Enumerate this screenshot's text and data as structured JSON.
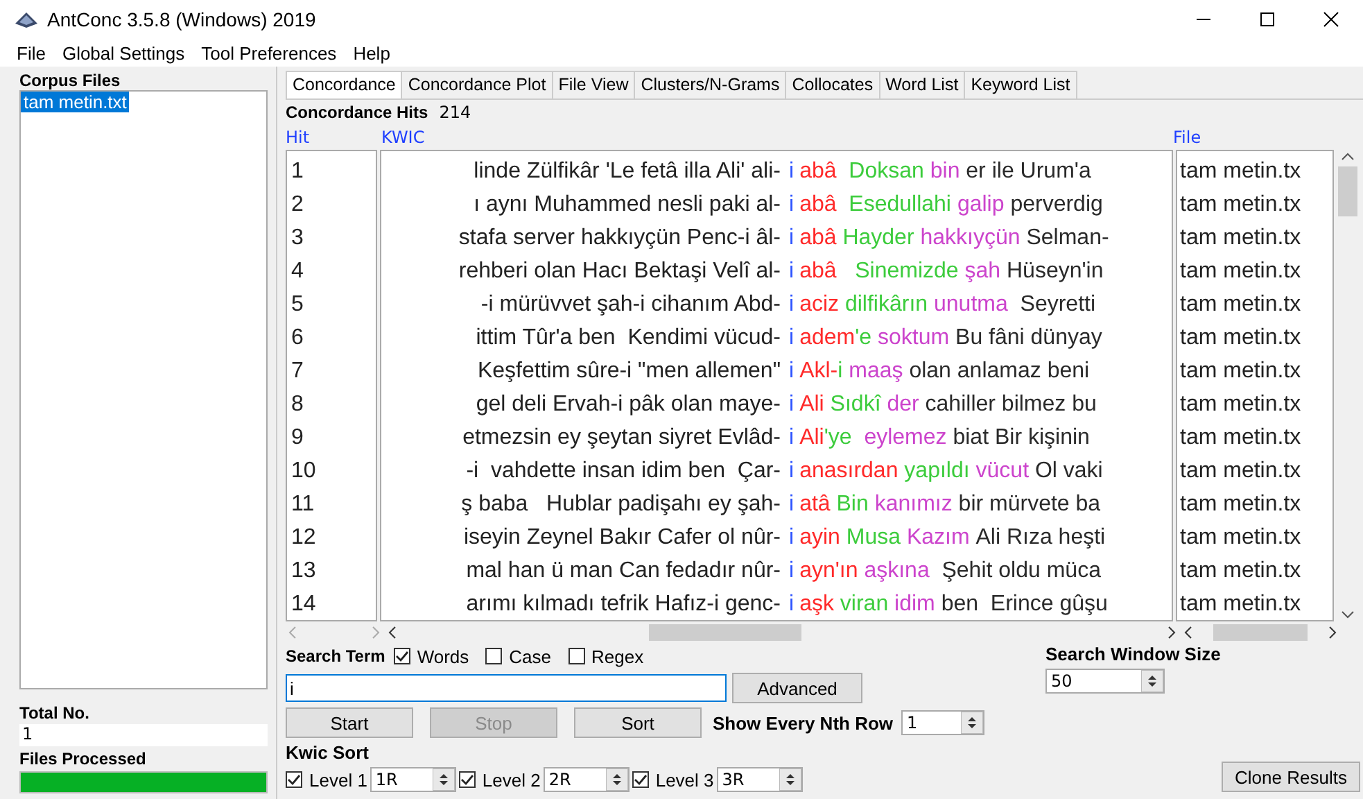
{
  "window": {
    "title": "AntConc 3.5.8 (Windows) 2019"
  },
  "menu": [
    "File",
    "Global Settings",
    "Tool Preferences",
    "Help"
  ],
  "corpus_files": {
    "title": "Corpus Files",
    "items": [
      {
        "label": "tam metin.txt",
        "selected": true
      }
    ],
    "total_label": "Total No.",
    "total_value": "1",
    "processed_label": "Files Processed",
    "processed": {
      "level": 1
    }
  },
  "tabs": [
    {
      "label": "Concordance",
      "selected": true
    },
    {
      "label": "Concordance Plot",
      "selected": false
    },
    {
      "label": "File View",
      "selected": false
    },
    {
      "label": "Clusters/N-Grams",
      "selected": false
    },
    {
      "label": "Collocates",
      "selected": false
    },
    {
      "label": "Word List",
      "selected": false
    },
    {
      "label": "Keyword List",
      "selected": false
    }
  ],
  "concordance": {
    "hits_label": "Concordance Hits",
    "hits_count": "214",
    "columns": [
      "Hit",
      "KWIC",
      "File"
    ],
    "rows": [
      {
        "hit": "1",
        "left": "linde Zülfikâr 'Le fetâ illa Ali' ali-",
        "node": "i",
        "right": [
          {
            "text": "abâ  ",
            "kind": "level1"
          },
          {
            "text": "Doksan ",
            "kind": "level2"
          },
          {
            "text": "bin ",
            "kind": "level3"
          },
          {
            "text": "er ile Urum'a",
            "kind": "plain"
          }
        ],
        "file": "tam metin.tx"
      },
      {
        "hit": "2",
        "left": "ı aynı Muhammed nesli paki al-",
        "node": "i",
        "right": [
          {
            "text": "abâ  ",
            "kind": "level1"
          },
          {
            "text": "Esedullahi ",
            "kind": "level2"
          },
          {
            "text": "galip ",
            "kind": "level3"
          },
          {
            "text": "perverdig",
            "kind": "plain"
          }
        ],
        "file": "tam metin.tx"
      },
      {
        "hit": "3",
        "left": "stafa server hakkıyçün Penc-i âl-",
        "node": "i",
        "right": [
          {
            "text": "abâ ",
            "kind": "level1"
          },
          {
            "text": "Hayder ",
            "kind": "level2"
          },
          {
            "text": "hakkıyçün ",
            "kind": "level3"
          },
          {
            "text": "Selman-",
            "kind": "plain"
          }
        ],
        "file": "tam metin.tx"
      },
      {
        "hit": "4",
        "left": "rehberi olan Hacı Bektaşi Velî al-",
        "node": "i",
        "right": [
          {
            "text": "abâ   ",
            "kind": "level1"
          },
          {
            "text": "Sinemizde ",
            "kind": "level2"
          },
          {
            "text": "şah ",
            "kind": "level3"
          },
          {
            "text": "Hüseyn'in",
            "kind": "plain"
          }
        ],
        "file": "tam metin.tx"
      },
      {
        "hit": "5",
        "left": "-i mürüvvet şah-i cihanım Abd-",
        "node": "i",
        "right": [
          {
            "text": "aciz ",
            "kind": "level1"
          },
          {
            "text": "dilfikârın ",
            "kind": "level2"
          },
          {
            "text": "unutma  ",
            "kind": "level3"
          },
          {
            "text": "Seyretti",
            "kind": "plain"
          }
        ],
        "file": "tam metin.tx"
      },
      {
        "hit": "6",
        "left": "ittim Tûr'a ben  Kendimi vücud-",
        "node": "i",
        "right": [
          {
            "text": "adem",
            "kind": "level1"
          },
          {
            "text": "'e ",
            "kind": "level2"
          },
          {
            "text": "soktum ",
            "kind": "level3"
          },
          {
            "text": "Bu fâni dünyay",
            "kind": "plain"
          }
        ],
        "file": "tam metin.tx"
      },
      {
        "hit": "7",
        "left": "Keşfettim sûre-i \"men allemen\"",
        "node": "i",
        "right": [
          {
            "text": "Akl-",
            "kind": "level1"
          },
          {
            "text": "i ",
            "kind": "level2"
          },
          {
            "text": "maaş ",
            "kind": "level3"
          },
          {
            "text": "olan anlamaz beni",
            "kind": "plain"
          }
        ],
        "file": "tam metin.tx"
      },
      {
        "hit": "8",
        "left": "gel deli Ervah-i pâk olan maye-",
        "node": "i",
        "right": [
          {
            "text": "Ali ",
            "kind": "level1"
          },
          {
            "text": "Sıdkî ",
            "kind": "level2"
          },
          {
            "text": "der ",
            "kind": "level3"
          },
          {
            "text": "cahiller bilmez bu",
            "kind": "plain"
          }
        ],
        "file": "tam metin.tx"
      },
      {
        "hit": "9",
        "left": "etmezsin ey şeytan siyret Evlâd-",
        "node": "i",
        "right": [
          {
            "text": "Ali",
            "kind": "level1"
          },
          {
            "text": "'ye  ",
            "kind": "level2"
          },
          {
            "text": "eylemez ",
            "kind": "level3"
          },
          {
            "text": "biat Bir kişinin",
            "kind": "plain"
          }
        ],
        "file": "tam metin.tx"
      },
      {
        "hit": "10",
        "left": "-i  vahdette insan idim ben  Çar-",
        "node": "i",
        "right": [
          {
            "text": "anasırdan ",
            "kind": "level1"
          },
          {
            "text": "yapıldı ",
            "kind": "level2"
          },
          {
            "text": "vücut ",
            "kind": "level3"
          },
          {
            "text": "Ol vaki",
            "kind": "plain"
          }
        ],
        "file": "tam metin.tx"
      },
      {
        "hit": "11",
        "left": "ş baba   Hublar padişahı ey şah-",
        "node": "i",
        "right": [
          {
            "text": "atâ ",
            "kind": "level1"
          },
          {
            "text": "Bin ",
            "kind": "level2"
          },
          {
            "text": "kanımız ",
            "kind": "level3"
          },
          {
            "text": "bir mürvete ba",
            "kind": "plain"
          }
        ],
        "file": "tam metin.tx"
      },
      {
        "hit": "12",
        "left": "iseyin Zeynel Bakır Cafer ol nûr-",
        "node": "i",
        "right": [
          {
            "text": "ayin ",
            "kind": "level1"
          },
          {
            "text": "Musa ",
            "kind": "level2"
          },
          {
            "text": "Kazım ",
            "kind": "level3"
          },
          {
            "text": "Ali Rıza heşti",
            "kind": "plain"
          }
        ],
        "file": "tam metin.tx"
      },
      {
        "hit": "13",
        "left": "mal han ü man Can fedadır nûr-",
        "node": "i",
        "right": [
          {
            "text": "ayn'ın ",
            "kind": "level1"
          },
          {
            "text": "aşkına  ",
            "kind": "level3"
          },
          {
            "text": "Şehit oldu müca",
            "kind": "plain"
          }
        ],
        "file": "tam metin.tx"
      },
      {
        "hit": "14",
        "left": "arımı kılmadı tefrik Hafız-i genc-",
        "node": "i",
        "right": [
          {
            "text": "aşk ",
            "kind": "level1"
          },
          {
            "text": "viran ",
            "kind": "level2"
          },
          {
            "text": "idim ",
            "kind": "level3"
          },
          {
            "text": "ben  Erince gûşu",
            "kind": "plain"
          }
        ],
        "file": "tam metin.tx"
      }
    ]
  },
  "search": {
    "label": "Search Term",
    "options": [
      {
        "label": "Words",
        "checked": true
      },
      {
        "label": "Case",
        "checked": false
      },
      {
        "label": "Regex",
        "checked": false
      }
    ],
    "value": "i",
    "advanced": "Advanced",
    "window_size_label": "Search Window Size",
    "window_size": "50"
  },
  "buttons": [
    {
      "label": "Start",
      "disabled": false
    },
    {
      "label": "Stop",
      "disabled": true
    },
    {
      "label": "Sort",
      "disabled": false
    }
  ],
  "nth_row": {
    "label": "Show Every Nth Row",
    "value": "1"
  },
  "kwic_sort": {
    "label": "Kwic Sort",
    "levels": [
      {
        "label": "Level 1",
        "checked": true,
        "value": "1R"
      },
      {
        "label": "Level 2",
        "checked": true,
        "value": "2R"
      },
      {
        "label": "Level 3",
        "checked": true,
        "value": "3R"
      }
    ]
  },
  "clone": "Clone Results"
}
